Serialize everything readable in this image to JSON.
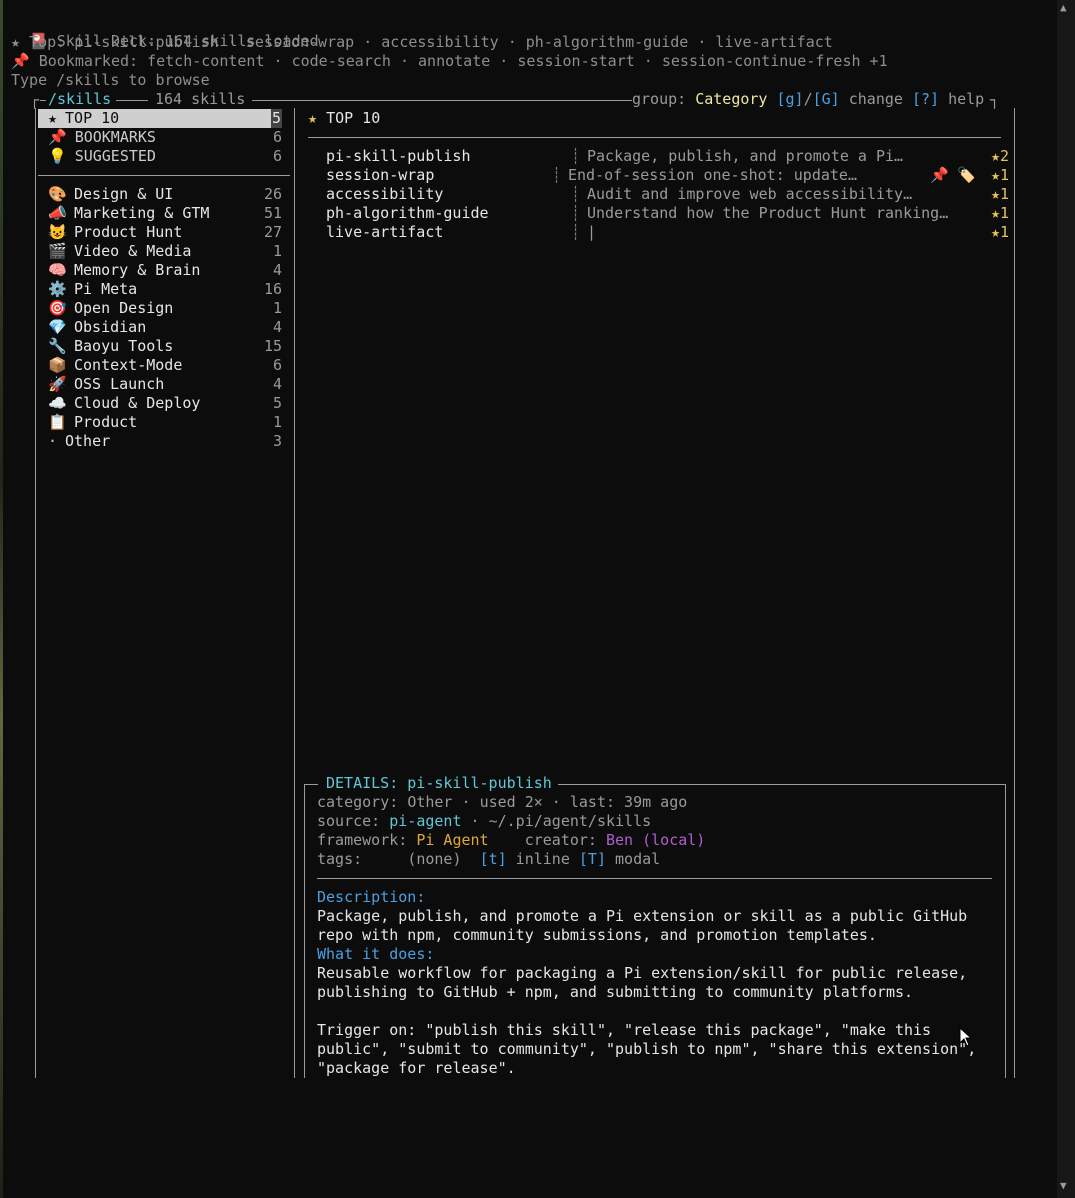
{
  "header": {
    "title": "Skill Deck: 164 skills loaded",
    "top_label": "Top: ",
    "top_list": "pi-skill-publish · session-wrap · accessibility · ph-algorithm-guide · live-artifact",
    "bookmarked_label": "Bookmarked: ",
    "bookmarked_list": "fetch-content · code-search · annotate · session-start · session-continue-fresh +1",
    "hint": "Type /skills to browse"
  },
  "panel": {
    "path": "/skills",
    "count_label": "164 skills",
    "group_label": "group: ",
    "group_value": "Category",
    "key_g": "[g]",
    "slash": "/",
    "key_G": "[G]",
    "change_label": " change ",
    "key_help": "[?]",
    "help_label": " help"
  },
  "sidebar": {
    "pinned": [
      {
        "icon": "★",
        "label": "TOP 10",
        "count": "5"
      },
      {
        "icon": "📌",
        "label": "BOOKMARKS",
        "count": "6"
      },
      {
        "icon": "💡",
        "label": "SUGGESTED",
        "count": "6"
      }
    ],
    "categories": [
      {
        "icon": "🎨",
        "label": "Design & UI",
        "count": "26"
      },
      {
        "icon": "📣",
        "label": "Marketing & GTM",
        "count": "51"
      },
      {
        "icon": "😺",
        "label": "Product Hunt",
        "count": "27"
      },
      {
        "icon": "🎬",
        "label": "Video & Media",
        "count": "1"
      },
      {
        "icon": "🧠",
        "label": "Memory & Brain",
        "count": "4"
      },
      {
        "icon": "⚙️",
        "label": "Pi Meta",
        "count": "16"
      },
      {
        "icon": "🎯",
        "label": "Open Design",
        "count": "1"
      },
      {
        "icon": "💎",
        "label": "Obsidian",
        "count": "4"
      },
      {
        "icon": "🔧",
        "label": "Baoyu Tools",
        "count": "15"
      },
      {
        "icon": "📦",
        "label": "Context-Mode",
        "count": "6"
      },
      {
        "icon": "🚀",
        "label": "OSS Launch",
        "count": "4"
      },
      {
        "icon": "☁️",
        "label": "Cloud & Deploy",
        "count": "5"
      },
      {
        "icon": "📋",
        "label": "Product",
        "count": "1"
      },
      {
        "icon": "·",
        "label": "Other",
        "count": "3"
      }
    ]
  },
  "list": {
    "heading_icon": "★",
    "heading": "TOP 10",
    "items": [
      {
        "name": "pi-skill-publish",
        "desc": "Package, publish, and promote a Pi…",
        "badge": "★2"
      },
      {
        "name": "session-wrap",
        "desc": "End-of-session one-shot: update…",
        "badge": "★1",
        "pin": "📌",
        "tag": "🏷️"
      },
      {
        "name": "accessibility",
        "desc": "Audit and improve web accessibility…",
        "badge": "★1"
      },
      {
        "name": "ph-algorithm-guide",
        "desc": "Understand how the Product Hunt ranking…",
        "badge": "★1"
      },
      {
        "name": "live-artifact",
        "desc": "",
        "badge": "★1"
      }
    ]
  },
  "details": {
    "title_label": "DETAILS: ",
    "title_value": "pi-skill-publish",
    "category_label": "category: ",
    "category_value": "Other",
    "used_label": "used 2×",
    "last_label": "last: 39m ago",
    "source_label": "source: ",
    "source_value": "pi-agent",
    "source_path": "~/.pi/agent/skills",
    "framework_label": "framework: ",
    "framework_value": "Pi Agent",
    "creator_label": "creator: ",
    "creator_value": "Ben (local)",
    "tags_label": "tags:",
    "tags_value": "(none)",
    "key_t": "[t]",
    "inline_label": " inline ",
    "key_T": "[T]",
    "modal_label": " modal",
    "description_heading": "Description:",
    "description_line1": "Package, publish, and promote a Pi extension or skill as a public GitHub",
    "description_line2": "repo with npm, community submissions, and promotion templates.",
    "what_heading": "What it does:",
    "what_line1": "Reusable workflow for packaging a Pi extension/skill for public release,",
    "what_line2": "publishing to GitHub + npm, and submitting to community platforms.",
    "trigger_line1": "Trigger on: \"publish this skill\", \"release this package\", \"make this",
    "trigger_line2": "public\", \"submit to community\", \"publish to npm\", \"share this extension\",",
    "trigger_line3": "\"package for release\"."
  }
}
